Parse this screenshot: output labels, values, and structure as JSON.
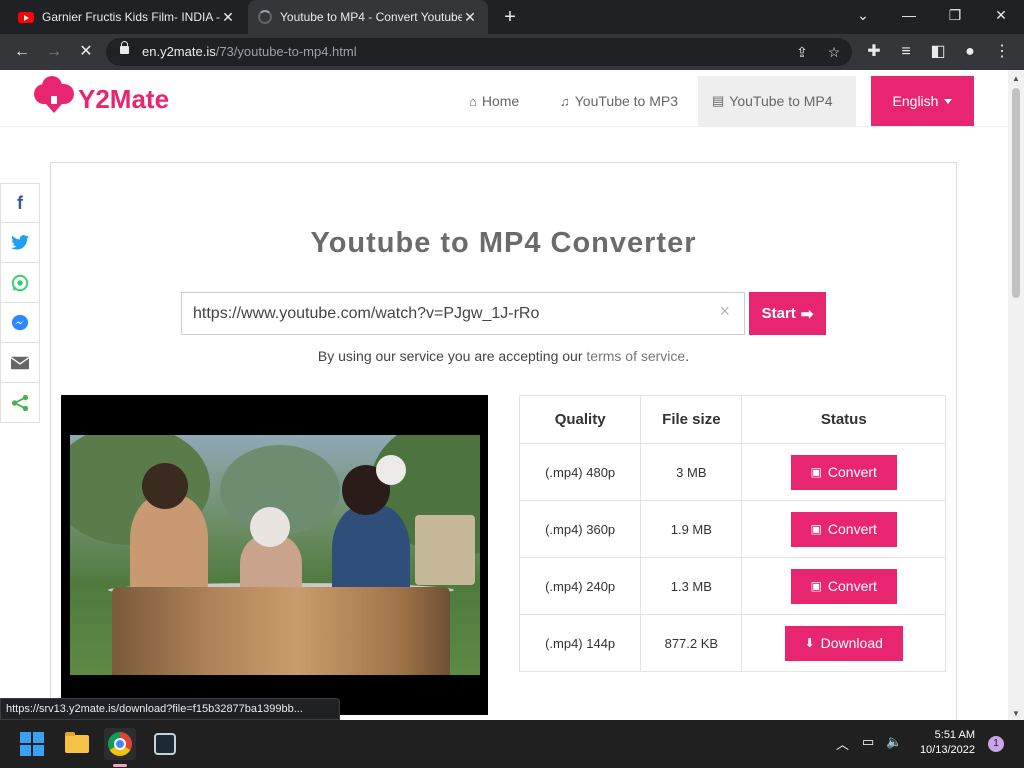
{
  "browser": {
    "tabs": [
      {
        "title": "Garnier Fructis Kids Film- INDIA -",
        "close": "✕"
      },
      {
        "title": "Youtube to MP4 - Convert Youtube",
        "close": "✕"
      }
    ],
    "new_tab": "+",
    "window_controls": {
      "minimize": "—",
      "restore": "❐",
      "close": "✕",
      "dropdown": "⌄"
    },
    "nav": {
      "back": "←",
      "forward": "→",
      "stop": "✕"
    },
    "url_host": "en.y2mate.is",
    "url_path": "/73/youtube-to-mp4.html",
    "status_url": "https://srv13.y2mate.is/download?file=f15b32877ba1399bb..."
  },
  "site": {
    "logo_text": "Y2Mate",
    "nav": [
      {
        "icon": "home-icon",
        "glyph": "⌂",
        "label": "Home"
      },
      {
        "icon": "music-icon",
        "glyph": "♫",
        "label": "YouTube to MP3"
      },
      {
        "icon": "film-icon",
        "glyph": "▤",
        "label": "YouTube to MP4"
      }
    ],
    "language": "English",
    "heading": "Youtube to MP4 Converter",
    "input_value": "https://www.youtube.com/watch?v=PJgw_1J-rRo",
    "clear": "×",
    "start_label": "Start",
    "start_arrow": "➡",
    "terms_prefix": "By using our service you are accepting our",
    "terms_link": "terms of service",
    "terms_suffix": ".",
    "table": {
      "headers": [
        "Quality",
        "File size",
        "Status"
      ],
      "rows": [
        {
          "quality": "(.mp4) 480p",
          "size": "3 MB",
          "action": "Convert",
          "icon": "▣"
        },
        {
          "quality": "(.mp4) 360p",
          "size": "1.9 MB",
          "action": "Convert",
          "icon": "▣"
        },
        {
          "quality": "(.mp4) 240p",
          "size": "1.3 MB",
          "action": "Convert",
          "icon": "▣"
        },
        {
          "quality": "(.mp4) 144p",
          "size": "877.2 KB",
          "action": "Download",
          "icon": "⬇"
        }
      ]
    }
  },
  "share": [
    "facebook",
    "twitter",
    "whatsapp",
    "messenger",
    "email",
    "share"
  ],
  "taskbar": {
    "time": "5:51 AM",
    "date": "10/13/2022",
    "notifications": "1"
  },
  "colors": {
    "accent": "#e8266f"
  }
}
